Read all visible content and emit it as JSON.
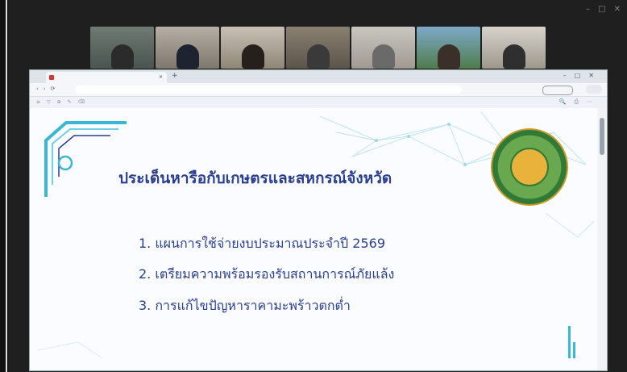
{
  "slide": {
    "title": "ประเด็นหารือกับเกษตรและสหกรณ์จังหวัด",
    "items": [
      "1. แผนการใช้จ่ายงบประมาณประจำปี 2569",
      "2. เตรียมความพร้อมรองรับสถานการณ์ภัยแล้ง",
      "3. การแก้ไขปัญหาราคามะพร้าวตกต่ำ"
    ]
  },
  "colors": {
    "title": "#2a3f8f",
    "meeting_bg": "#1f1f1f",
    "accent_cyan": "#39b8d6"
  }
}
